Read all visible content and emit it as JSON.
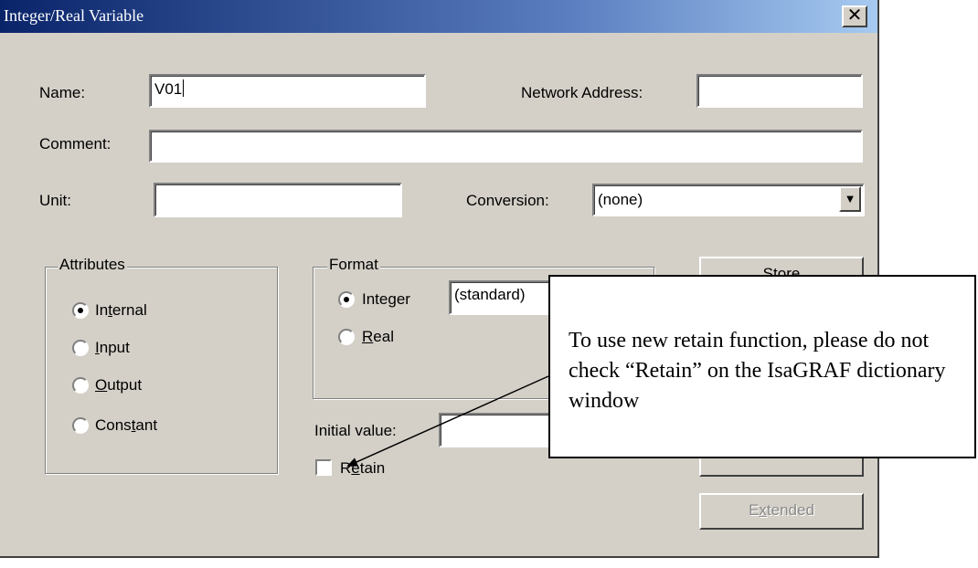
{
  "window": {
    "title": "Integer/Real Variable",
    "close_glyph": "✕"
  },
  "fields": {
    "name_label": "Name:",
    "name_value": "V01",
    "network_address_label": "Network Address:",
    "network_address_value": "",
    "comment_label": "Comment:",
    "comment_value": "",
    "unit_label": "Unit:",
    "unit_value": "",
    "conversion_label": "Conversion:",
    "conversion_value": "(none)",
    "initial_value_label": "Initial value:",
    "initial_value_value": ""
  },
  "attributes": {
    "title": "Attributes",
    "options": [
      {
        "pre": "In",
        "ul": "t",
        "post": "ernal",
        "checked": true
      },
      {
        "pre": "",
        "ul": "I",
        "post": "nput",
        "checked": false
      },
      {
        "pre": "",
        "ul": "O",
        "post": "utput",
        "checked": false
      },
      {
        "pre": "Cons",
        "ul": "t",
        "post": "ant",
        "checked": false
      }
    ]
  },
  "format": {
    "title": "Format",
    "integer": {
      "pre": "Inte",
      "ul": "g",
      "post": "er",
      "checked": true
    },
    "real": {
      "pre": "",
      "ul": "R",
      "post": "eal",
      "checked": false
    },
    "format_select_value": "(standard)"
  },
  "retain": {
    "pre": "R",
    "ul": "e",
    "post": "tain",
    "checked": false
  },
  "buttons": {
    "store": "Store",
    "extended": {
      "pre": "E",
      "ul": "x",
      "post": "tended",
      "enabled": false
    }
  },
  "callout": {
    "text": "To use new retain function, please do not check “Retain” on the IsaGRAF dictionary window"
  },
  "colors": {
    "dialog_bg": "#d4d0c8",
    "title_start": "#0a246a",
    "title_end": "#a6caf0",
    "disabled_text": "#8a8a8a"
  }
}
